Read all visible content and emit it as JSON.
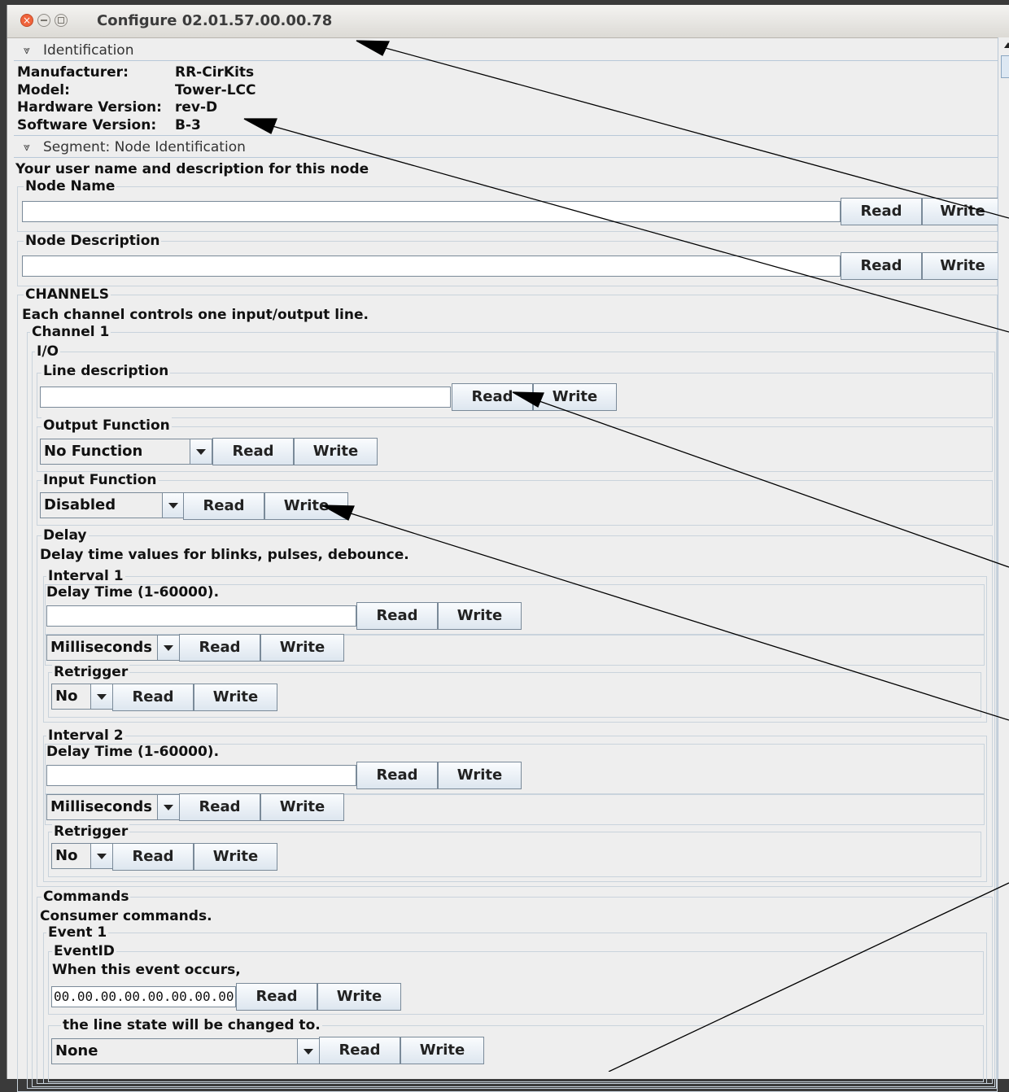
{
  "window": {
    "title": "Configure 02.01.57.00.00.78"
  },
  "identification": {
    "header": "Identification",
    "rows": [
      {
        "key": "Manufacturer:",
        "value": "RR-CirKits"
      },
      {
        "key": "Model:",
        "value": "Tower-LCC"
      },
      {
        "key": "Hardware Version:",
        "value": "rev-D"
      },
      {
        "key": "Software Version:",
        "value": "B-3"
      }
    ]
  },
  "segment": {
    "header": "Segment: Node Identification",
    "description": "Your user name and description for this node",
    "node_name_label": "Node Name",
    "node_description_label": "Node Description"
  },
  "buttons": {
    "read": "Read",
    "write": "Write"
  },
  "channels": {
    "label": "CHANNELS",
    "description": "Each channel controls one input/output line.",
    "channel_label": "Channel 1",
    "io_label": "I/O",
    "line_description_label": "Line description",
    "output_function_label": "Output Function",
    "output_function_value": "No Function",
    "input_function_label": "Input Function",
    "input_function_value": "Disabled",
    "delay_label": "Delay",
    "delay_description": "Delay time values for blinks, pulses, debounce.",
    "intervals": [
      {
        "label": "Interval 1",
        "time_label": "Delay Time (1-60000).",
        "unit": "Milliseconds",
        "retrigger_label": "Retrigger",
        "retrigger_value": "No"
      },
      {
        "label": "Interval 2",
        "time_label": "Delay Time (1-60000).",
        "unit": "Milliseconds",
        "retrigger_label": "Retrigger",
        "retrigger_value": "No"
      }
    ],
    "commands_label": "Commands",
    "commands_description": "Consumer commands.",
    "event_label": "Event 1",
    "eventid_label": "EventID",
    "event_occurs_label": "When this event occurs,",
    "event_id_value": "00.00.00.00.00.00.00.00",
    "line_state_label": "the line state will be changed to.",
    "line_state_value": "None"
  }
}
